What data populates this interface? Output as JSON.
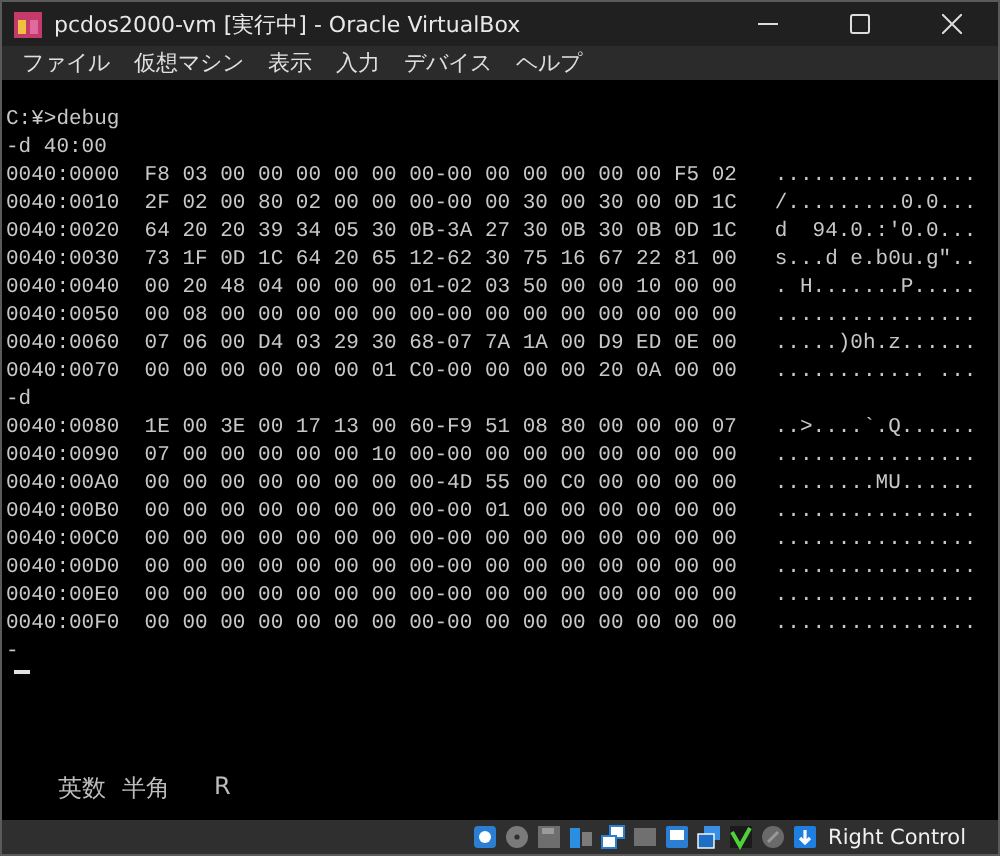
{
  "window": {
    "title": "pcdos2000-vm [実行中] - Oracle VirtualBox"
  },
  "menu": [
    "ファイル",
    "仮想マシン",
    "表示",
    "入力",
    "デバイス",
    "ヘルプ"
  ],
  "terminal": {
    "lines": [
      "C:¥>debug",
      "-d 40:00",
      "0040:0000  F8 03 00 00 00 00 00 00-00 00 00 00 00 00 F5 02   ................",
      "0040:0010  2F 02 00 80 02 00 00 00-00 00 30 00 30 00 0D 1C   /.........0.0...",
      "0040:0020  64 20 20 39 34 05 30 0B-3A 27 30 0B 30 0B 0D 1C   d  94.0.:'0.0...",
      "0040:0030  73 1F 0D 1C 64 20 65 12-62 30 75 16 67 22 81 00   s...d e.b0u.g\"..",
      "0040:0040  00 20 48 04 00 00 00 01-02 03 50 00 00 10 00 00   . H.......P.....",
      "0040:0050  00 08 00 00 00 00 00 00-00 00 00 00 00 00 00 00   ................",
      "0040:0060  07 06 00 D4 03 29 30 68-07 7A 1A 00 D9 ED 0E 00   .....)0h.z......",
      "0040:0070  00 00 00 00 00 00 01 C0-00 00 00 00 20 0A 00 00   ............ ...",
      "-d",
      "0040:0080  1E 00 3E 00 17 13 00 60-F9 51 08 80 00 00 00 07   ..>....`.Q......",
      "0040:0090  07 00 00 00 00 00 10 00-00 00 00 00 00 00 00 00   ................",
      "0040:00A0  00 00 00 00 00 00 00 00-4D 55 00 C0 00 00 00 00   ........MU......",
      "0040:00B0  00 00 00 00 00 00 00 00-00 01 00 00 00 00 00 00   ................",
      "0040:00C0  00 00 00 00 00 00 00 00-00 00 00 00 00 00 00 00   ................",
      "0040:00D0  00 00 00 00 00 00 00 00-00 00 00 00 00 00 00 00   ................",
      "0040:00E0  00 00 00 00 00 00 00 00-00 00 00 00 00 00 00 00   ................",
      "0040:00F0  00 00 00 00 00 00 00 00-00 00 00 00 00 00 00 00   ................",
      "-"
    ],
    "ime": [
      "英数",
      "半角",
      "R"
    ]
  },
  "status_bar": {
    "host_key": "Right Control"
  }
}
